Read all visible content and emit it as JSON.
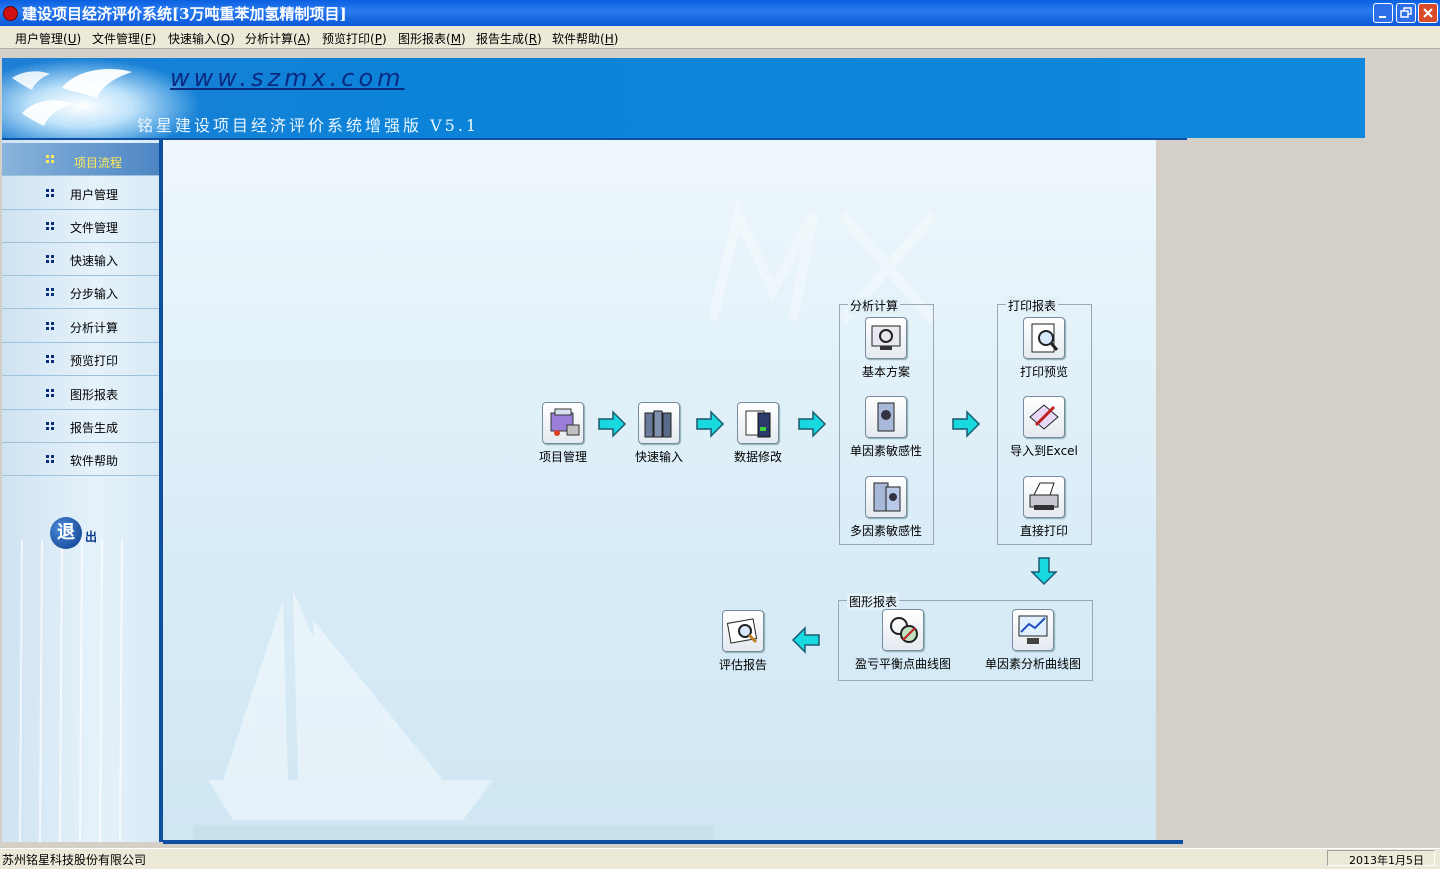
{
  "window": {
    "title": "建设项目经济评价系统[3万吨重苯加氢精制项目]",
    "icons": {
      "app": "apple-icon",
      "minimize": "minimize-icon",
      "maximize": "restore-icon",
      "close": "close-icon"
    }
  },
  "menu": {
    "items": [
      {
        "label": "用户管理(",
        "acc": "U",
        "end": ")"
      },
      {
        "label": "文件管理(",
        "acc": "F",
        "end": ")"
      },
      {
        "label": "快速输入(",
        "acc": "Q",
        "end": ")"
      },
      {
        "label": "分析计算(",
        "acc": "A",
        "end": ")"
      },
      {
        "label": "预览打印(",
        "acc": "P",
        "end": ")"
      },
      {
        "label": "图形报表(",
        "acc": "M",
        "end": ")"
      },
      {
        "label": "报告生成(",
        "acc": "R",
        "end": ")"
      },
      {
        "label": "软件帮助(",
        "acc": "H",
        "end": ")"
      }
    ]
  },
  "banner": {
    "url": "www.szmx.com",
    "subtitle": "铭星建设项目经济评价系统增强版 V5.1"
  },
  "sidebar": {
    "items": [
      {
        "label": "项目流程",
        "active": true
      },
      {
        "label": "用户管理",
        "active": false
      },
      {
        "label": "文件管理",
        "active": false
      },
      {
        "label": "快速输入",
        "active": false
      },
      {
        "label": "分步输入",
        "active": false
      },
      {
        "label": "分析计算",
        "active": false
      },
      {
        "label": "预览打印",
        "active": false
      },
      {
        "label": "图形报表",
        "active": false
      },
      {
        "label": "报告生成",
        "active": false
      },
      {
        "label": "软件帮助",
        "active": false
      }
    ],
    "exit": {
      "big": "退",
      "small": "出"
    }
  },
  "flow": {
    "project_manage": {
      "label": "项目管理",
      "icon": "project-manage-icon"
    },
    "quick_input": {
      "label": "快速输入",
      "icon": "quick-input-icon"
    },
    "data_modify": {
      "label": "数据修改",
      "icon": "data-modify-icon"
    },
    "analysis_group": {
      "title": "分析计算",
      "items": [
        {
          "label": "基本方案",
          "icon": "base-plan-icon"
        },
        {
          "label": "单因素敏感性",
          "icon": "single-factor-icon"
        },
        {
          "label": "多因素敏感性",
          "icon": "multi-factor-icon"
        }
      ]
    },
    "print_group": {
      "title": "打印报表",
      "items": [
        {
          "label": "打印预览",
          "icon": "print-preview-icon"
        },
        {
          "label": "导入到Excel",
          "icon": "export-excel-icon"
        },
        {
          "label": "直接打印",
          "icon": "printer-icon"
        }
      ]
    },
    "chart_group": {
      "title": "图形报表",
      "items": [
        {
          "label": "盈亏平衡点曲线图",
          "icon": "breakeven-chart-icon"
        },
        {
          "label": "单因素分析曲线图",
          "icon": "single-factor-chart-icon"
        }
      ]
    },
    "report": {
      "label": "评估报告",
      "icon": "report-icon"
    }
  },
  "status": {
    "company": "苏州铭星科技股份有限公司",
    "date": "2013年1月5日"
  },
  "colors": {
    "title_bar": "#0a5fe0",
    "banner": "#0d88dc",
    "arrow": "#18d8e0",
    "sidebar_active_text": "#ffe85a"
  }
}
